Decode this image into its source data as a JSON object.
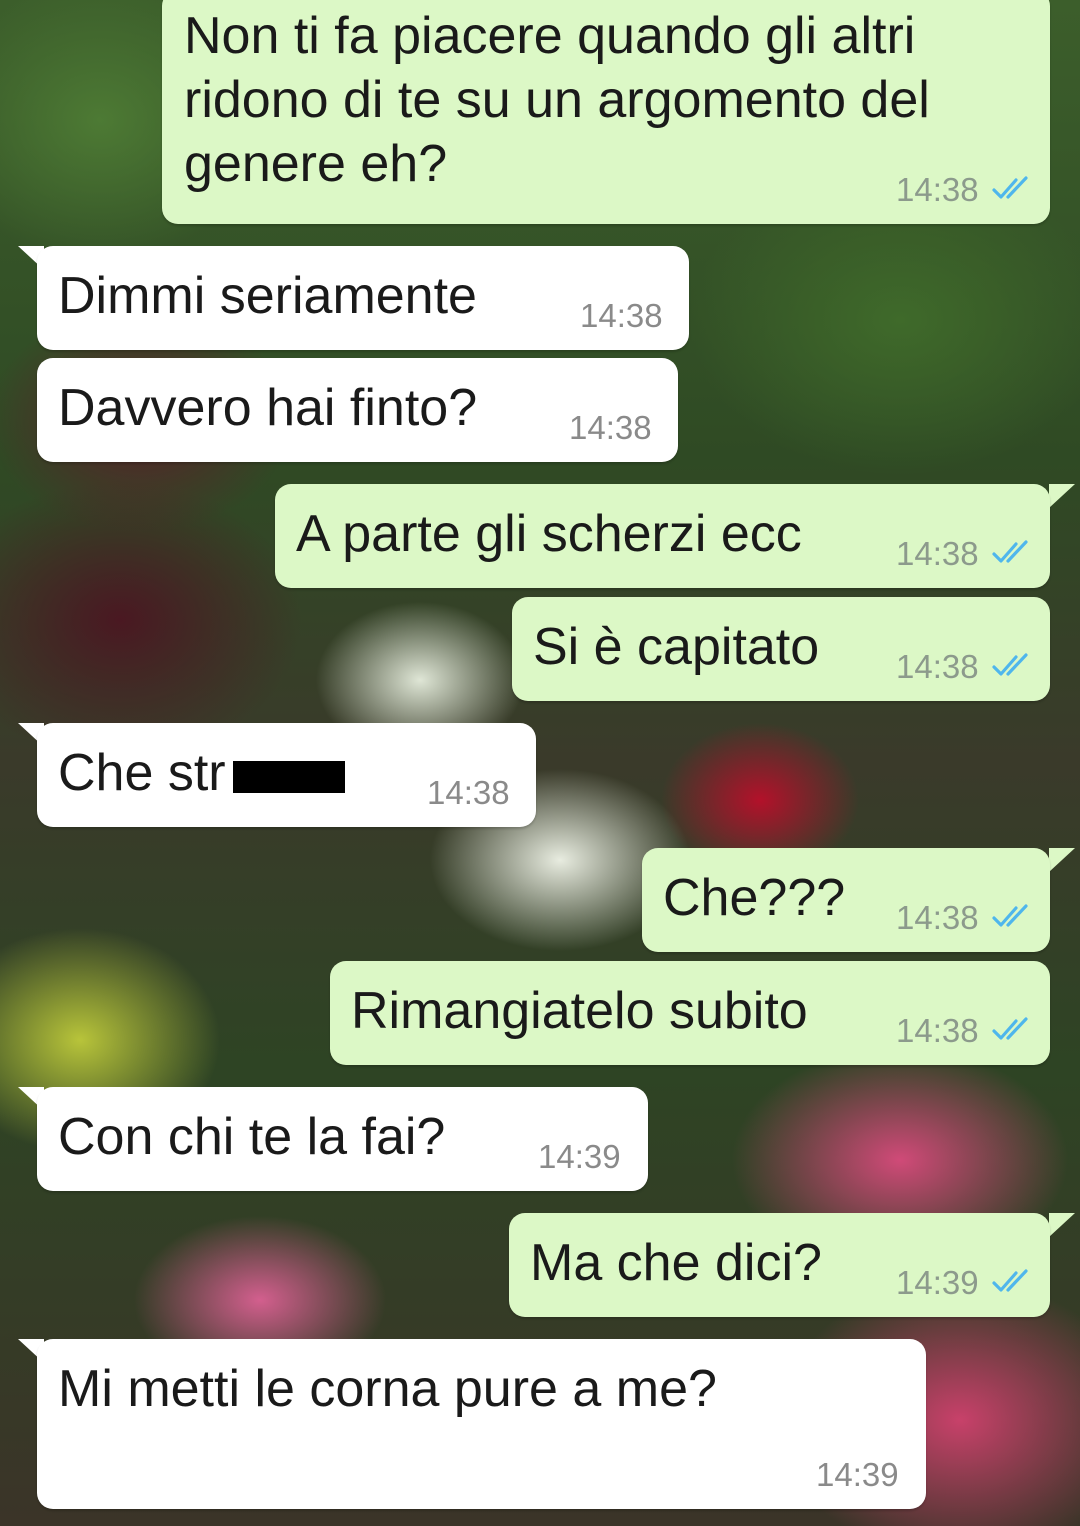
{
  "messages": [
    {
      "direction": "outgoing",
      "text": "Non ti fa piacere quando gli altri\nridono di te su un argomento del\ngenere eh?",
      "time": "14:38",
      "status": "read"
    },
    {
      "direction": "incoming",
      "text": "Dimmi seriamente",
      "time": "14:38"
    },
    {
      "direction": "incoming",
      "text": "Davvero hai finto?",
      "time": "14:38"
    },
    {
      "direction": "outgoing",
      "text": "A parte gli scherzi ecc",
      "time": "14:38",
      "status": "read"
    },
    {
      "direction": "outgoing",
      "text": "Si è capitato",
      "time": "14:38",
      "status": "read"
    },
    {
      "direction": "incoming",
      "text": "Che str",
      "time": "14:38",
      "redacted": true
    },
    {
      "direction": "outgoing",
      "text": "Che???",
      "time": "14:38",
      "status": "read"
    },
    {
      "direction": "outgoing",
      "text": "Rimangiatelo subito",
      "time": "14:38",
      "status": "read"
    },
    {
      "direction": "incoming",
      "text": "Con chi te la fai?",
      "time": "14:39"
    },
    {
      "direction": "outgoing",
      "text": "Ma che dici?",
      "time": "14:39",
      "status": "read"
    },
    {
      "direction": "incoming",
      "text": "Mi metti le corna pure a me?",
      "time": "14:39"
    }
  ],
  "colors": {
    "outgoing_bubble": "#dcf8c6",
    "incoming_bubble": "#ffffff",
    "read_ticks": "#4fb6ec"
  },
  "icons": {
    "read_receipt": "double-check-icon"
  }
}
